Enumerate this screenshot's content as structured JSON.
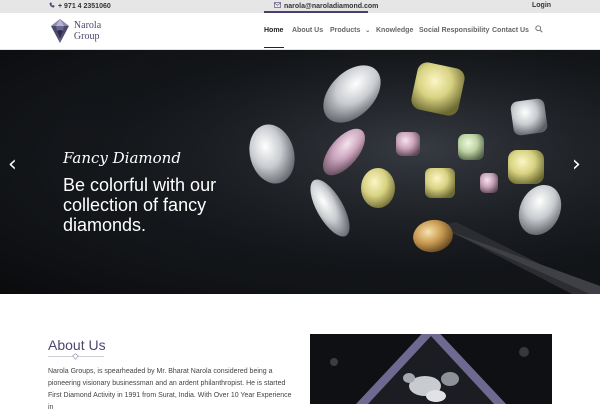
{
  "topbar": {
    "phone": "+ 971 4 2351060",
    "phone_icon": "phone-icon",
    "email": "narola@naroladiamond.com",
    "email_icon": "envelope-icon",
    "login": "Login"
  },
  "header": {
    "logo_text": "Narola Group",
    "nav": [
      {
        "label": "Home",
        "active": true
      },
      {
        "label": "About Us"
      },
      {
        "label": "Products",
        "has_dropdown": true
      },
      {
        "label": "Knowledge"
      },
      {
        "label": "Social Responsibility"
      },
      {
        "label": "Contact Us"
      }
    ],
    "search_icon": "search-icon"
  },
  "hero": {
    "subtitle": "Fancy Diamond",
    "headline": "Be colorful with our collection of fancy diamonds.",
    "prev_icon": "chevron-left-icon",
    "next_icon": "chevron-right-icon"
  },
  "about": {
    "title": "About Us",
    "text": "Narola Groups, is spearheaded by Mr. Bharat Narola considered being a pioneering visionary businessman and an ardent philanthropist. He is started First Diamond Activity in 1991 from Surat, India. With Over 10 Year Experience in"
  },
  "colors": {
    "brand": "#4b4a6e",
    "topbar_bg": "#e6e6e6",
    "hero_bg": "#15181c"
  }
}
